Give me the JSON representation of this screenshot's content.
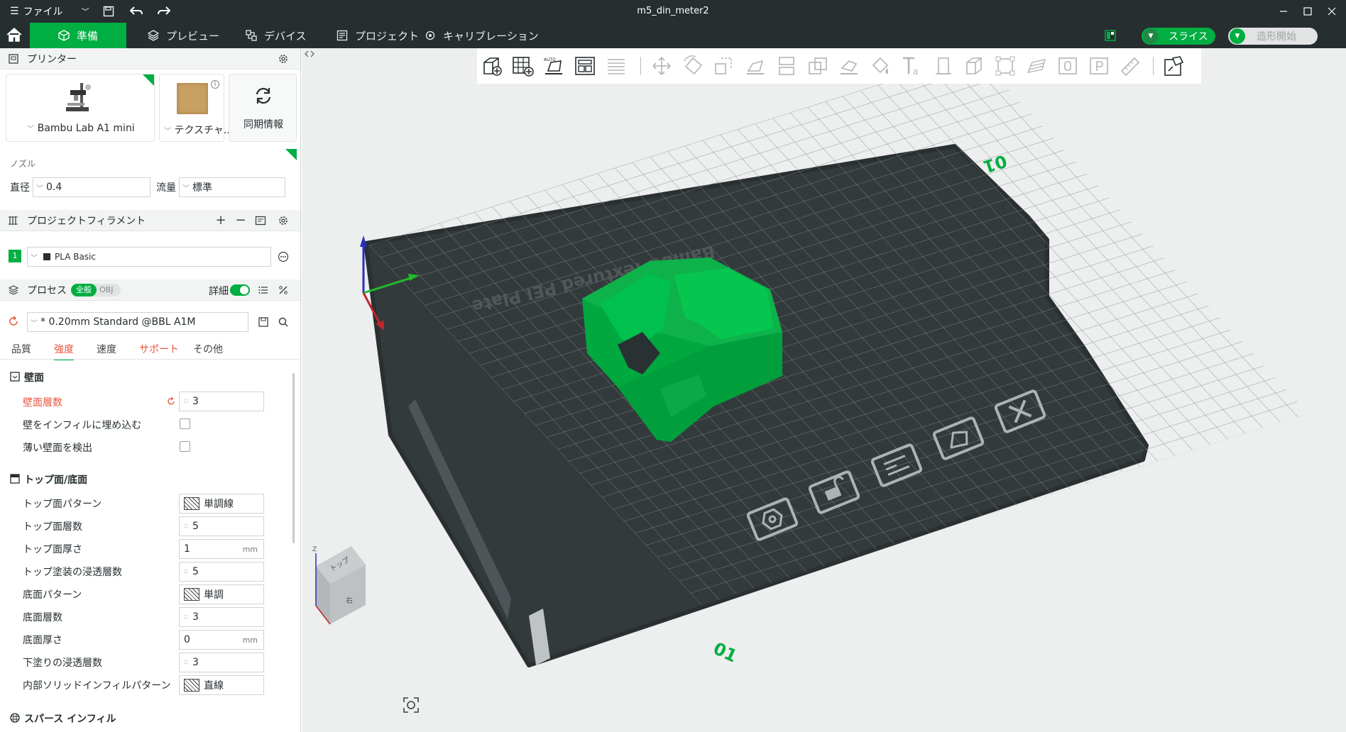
{
  "window": {
    "title": "m5_din_meter2",
    "menu_label": "ファイル"
  },
  "nav": {
    "tabs": [
      {
        "label": "準備",
        "icon": "cube-icon"
      },
      {
        "label": "プレビュー",
        "icon": "layers-icon"
      },
      {
        "label": "デバイス",
        "icon": "device-icon"
      },
      {
        "label": "プロジェクト",
        "icon": "project-icon"
      },
      {
        "label": "キャリブレーション",
        "icon": "calibration-icon"
      }
    ],
    "slice_label": "スライス",
    "print_label": "造形開始"
  },
  "printer": {
    "header": "プリンター",
    "printer_name": "Bambu Lab A1 mini",
    "plate_name": "テクスチャ...",
    "sync_label": "同期情報",
    "nozzle_header": "ノズル",
    "diameter_label": "直径",
    "diameter_value": "0.4",
    "flow_label": "流量",
    "flow_value": "標準"
  },
  "filament": {
    "header": "プロジェクトフィラメント",
    "items": [
      {
        "index": "1",
        "name": "PLA Basic",
        "color": "#00ae42"
      }
    ]
  },
  "process": {
    "header": "プロセス",
    "toggle_all": "全般",
    "toggle_obj": "OBJ",
    "detail_label": "詳細",
    "preset": "* 0.20mm Standard @BBL A1M",
    "tabs": [
      "品質",
      "強度",
      "速度",
      "サポート",
      "その他"
    ],
    "active_tab": "強度"
  },
  "settings": {
    "wall_section": "壁面",
    "wall_loops_label": "壁面層数",
    "wall_loops_value": "3",
    "embed_wall_label": "壁をインフィルに埋め込む",
    "detect_thin_label": "薄い壁面を検出",
    "top_bottom_section": "トップ面/底面",
    "top_pattern_label": "トップ面パターン",
    "top_pattern_value": "単調線",
    "top_layers_label": "トップ面層数",
    "top_layers_value": "5",
    "top_thickness_label": "トップ面厚さ",
    "top_thickness_value": "1",
    "top_thickness_unit": "mm",
    "top_surface_density_label": "トップ塗装の浸透層数",
    "top_surface_density_value": "5",
    "bottom_pattern_label": "底面パターン",
    "bottom_pattern_value": "単調",
    "bottom_layers_label": "底面層数",
    "bottom_layers_value": "3",
    "bottom_thickness_label": "底面厚さ",
    "bottom_thickness_value": "0",
    "bottom_thickness_unit": "mm",
    "bottom_density_label": "下塗りの浸透層数",
    "bottom_density_value": "3",
    "internal_solid_label": "内部ソリッドインフィルパターン",
    "internal_solid_value": "直線",
    "sparse_section": "スパース インフィル"
  },
  "viewport": {
    "plate_text": "Bambu Textured PEI Plate",
    "plate_number": "01",
    "cube_top": "トップ",
    "cube_right": "右",
    "axis_z": "Z",
    "model_color": "#00ae42"
  }
}
